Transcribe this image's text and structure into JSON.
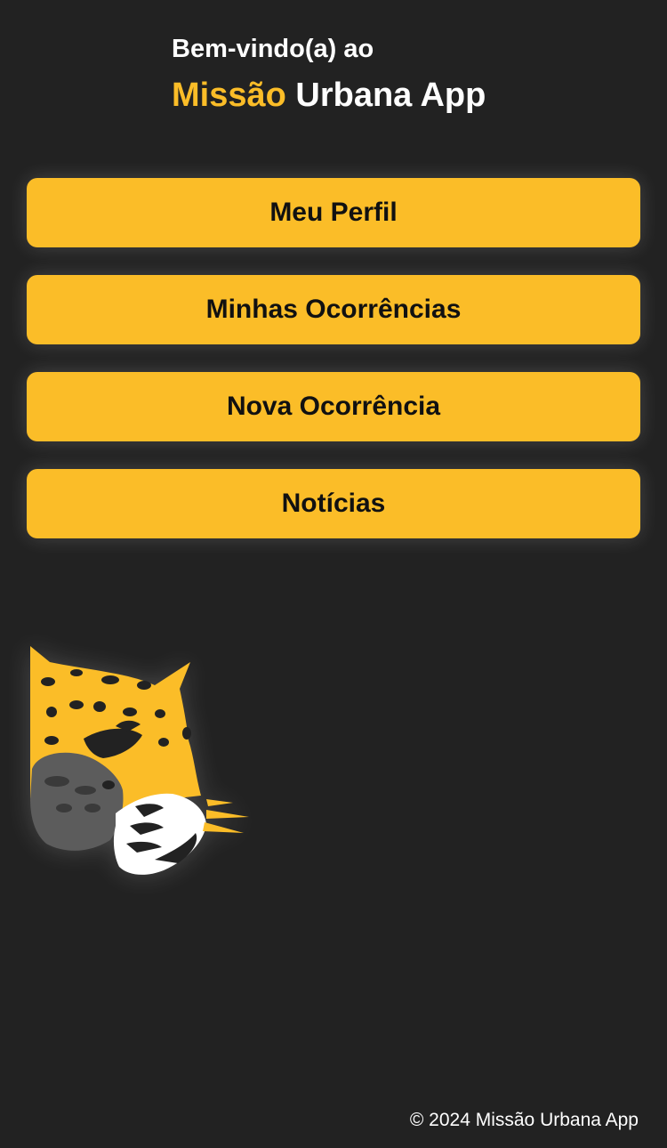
{
  "header": {
    "welcome": "Bem-vindo(a) ao",
    "title_accent": "Missão",
    "title_rest": " Urbana App"
  },
  "menu": {
    "items": [
      {
        "label": "Meu Perfil"
      },
      {
        "label": "Minhas Ocorrências"
      },
      {
        "label": "Nova Ocorrência"
      },
      {
        "label": "Notícias"
      }
    ]
  },
  "logo": {
    "icon": "jaguar-head-icon"
  },
  "footer": {
    "copyright": "© 2024 Missão Urbana App"
  },
  "colors": {
    "background": "#222222",
    "accent": "#fbbd28",
    "text": "#ffffff"
  }
}
